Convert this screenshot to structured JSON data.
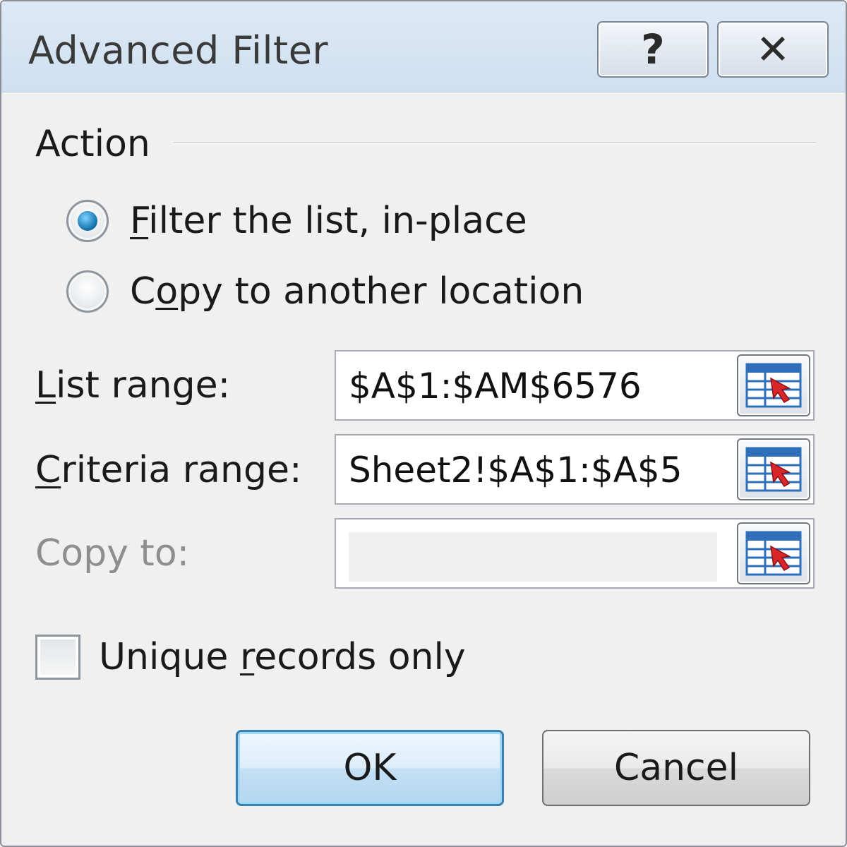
{
  "window": {
    "title": "Advanced Filter",
    "help_glyph": "?",
    "close_glyph": "✕"
  },
  "action": {
    "section_label": "Action",
    "filter_in_place": {
      "label_mnemonic": "F",
      "label_rest": "ilter the list, in-place",
      "selected": true
    },
    "copy_to_location": {
      "label_pre": "C",
      "label_mnemonic": "o",
      "label_rest": "py to another location",
      "selected": false
    }
  },
  "fields": {
    "list_range": {
      "label_mnemonic": "L",
      "label_rest": "ist range:",
      "value": "$A$1:$AM$6576"
    },
    "criteria_range": {
      "label_mnemonic": "C",
      "label_rest": "riteria range:",
      "value": "Sheet2!$A$1:$A$5"
    },
    "copy_to": {
      "label": "Copy to:",
      "value": ""
    }
  },
  "unique_records": {
    "label_pre": "Unique ",
    "label_mnemonic": "r",
    "label_rest": "ecords only",
    "checked": false
  },
  "buttons": {
    "ok": "OK",
    "cancel": "Cancel"
  },
  "colors": {
    "radio_selected": "#0d6ea8",
    "ok_border": "#3c7fb1",
    "picker_red": "#d8262b",
    "picker_blue": "#2f6fb9"
  },
  "icons": {
    "picker": "range-picker-icon",
    "help": "help-icon",
    "close": "close-icon"
  }
}
